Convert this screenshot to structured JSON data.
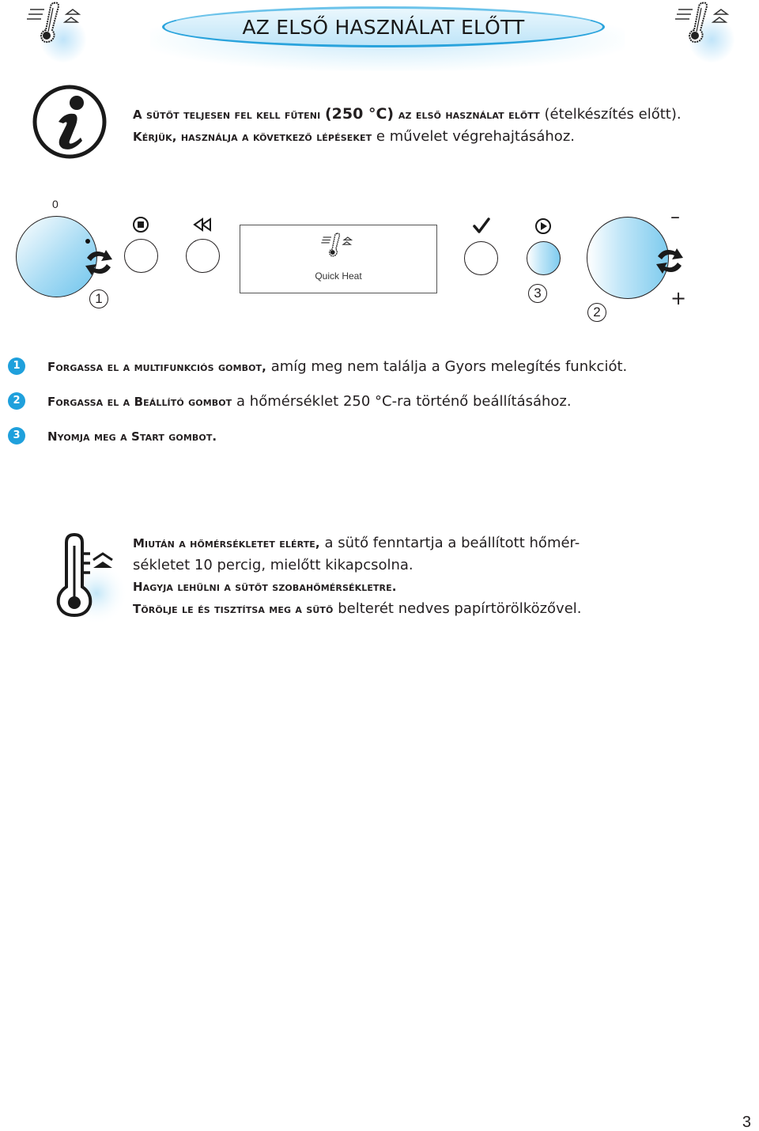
{
  "header": {
    "title": "AZ ELSŐ HASZNÁLAT ELŐTT",
    "left_icon": "quick-heat-thermometer-icon",
    "right_icon": "quick-heat-thermometer-icon"
  },
  "intro": {
    "icon": "info-icon",
    "line1_sc1": "A sütőt teljesen fel kell fűteni",
    "line1_bold": "(250 °C)",
    "line1_sc2": "az első használat előtt",
    "line1_regular": "(ételkészítés előtt).",
    "line2_sc": "Kérjük, használja a következő lépéseket",
    "line2_regular": "e művelet végrehajtásához."
  },
  "panel": {
    "multifunction_knob_zero_label": "0",
    "stop_button_icon": "stop-icon",
    "back_button_icon": "rewind-icon",
    "display_icon": "quick-heat-thermometer-icon",
    "display_text": "Quick Heat",
    "confirm_button_icon": "checkmark-icon",
    "start_button_icon": "play-icon",
    "setting_knob_minus": "–",
    "setting_knob_plus": "+",
    "callout_1": "1",
    "callout_2": "2",
    "callout_3": "3"
  },
  "steps": [
    {
      "number": "1",
      "sc": "Forgassa el a multifunkciós gombot,",
      "regular": "amíg meg nem találja a Gyors melegítés funkciót."
    },
    {
      "number": "2",
      "sc": "Forgassa el a Beállító gombot",
      "regular": "a hőmérséklet 250 °C-ra történő beállításához."
    },
    {
      "number": "3",
      "sc": "Nyomja meg a Start gombot.",
      "regular": ""
    }
  ],
  "note": {
    "icon": "thermometer-rising-icon",
    "line1_sc": "Miután a hőmérsékletet elérte,",
    "line1_regular": "a sütő fenntartja a beállított hőmér-",
    "line2_regular": "sékletet 10 percig, mielőtt kikapcsolna.",
    "line3_sc": "Hagyja lehűlni a sütőt szobahőmérsékletre.",
    "line4_sc": "Törölje le és tisztítsa meg a sütő",
    "line4_regular": "belterét nedves papírtörölközővel."
  },
  "page_number": "3"
}
